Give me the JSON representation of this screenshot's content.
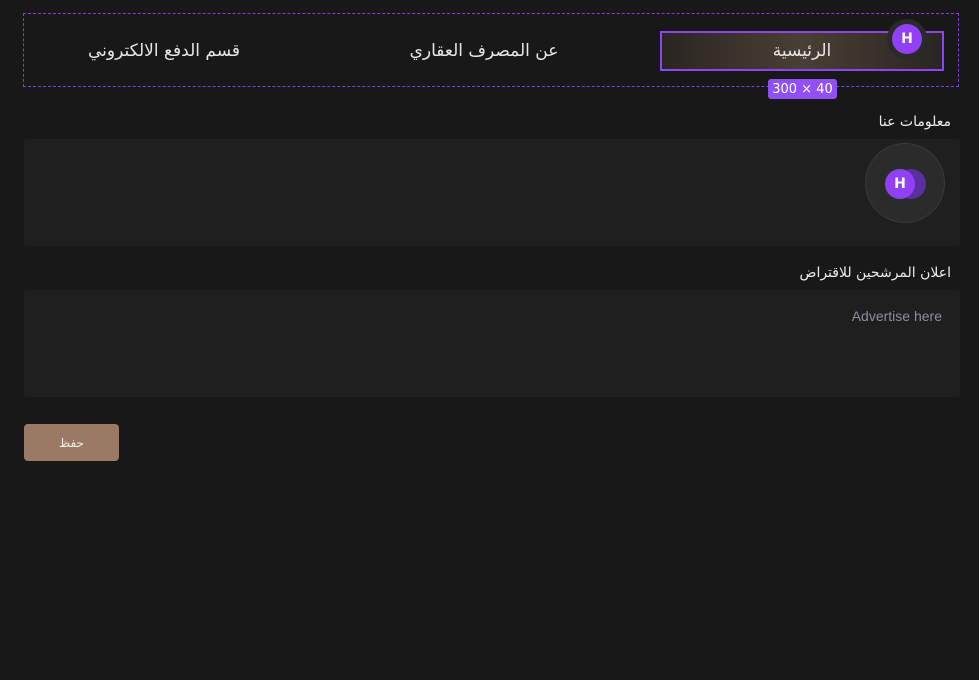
{
  "tabs": {
    "main": "الرئيسية",
    "about": "عن المصرف العقاري",
    "payment": "قسم الدفع الالكتروني"
  },
  "size_badge": "300 × 40",
  "avatar_letter": "H",
  "about_field": {
    "label": "معلومات عنا",
    "value": "",
    "placeholder": ""
  },
  "ad_field": {
    "label": "اعلان  المرشحين للاقتراض",
    "value": "",
    "placeholder": "Advertise here"
  },
  "save_button": "حفظ",
  "colors": {
    "background": "#181818",
    "accent": "#8b45f2",
    "save_button": "#9a7a65"
  },
  "icons": [
    "user-avatar-icon"
  ]
}
